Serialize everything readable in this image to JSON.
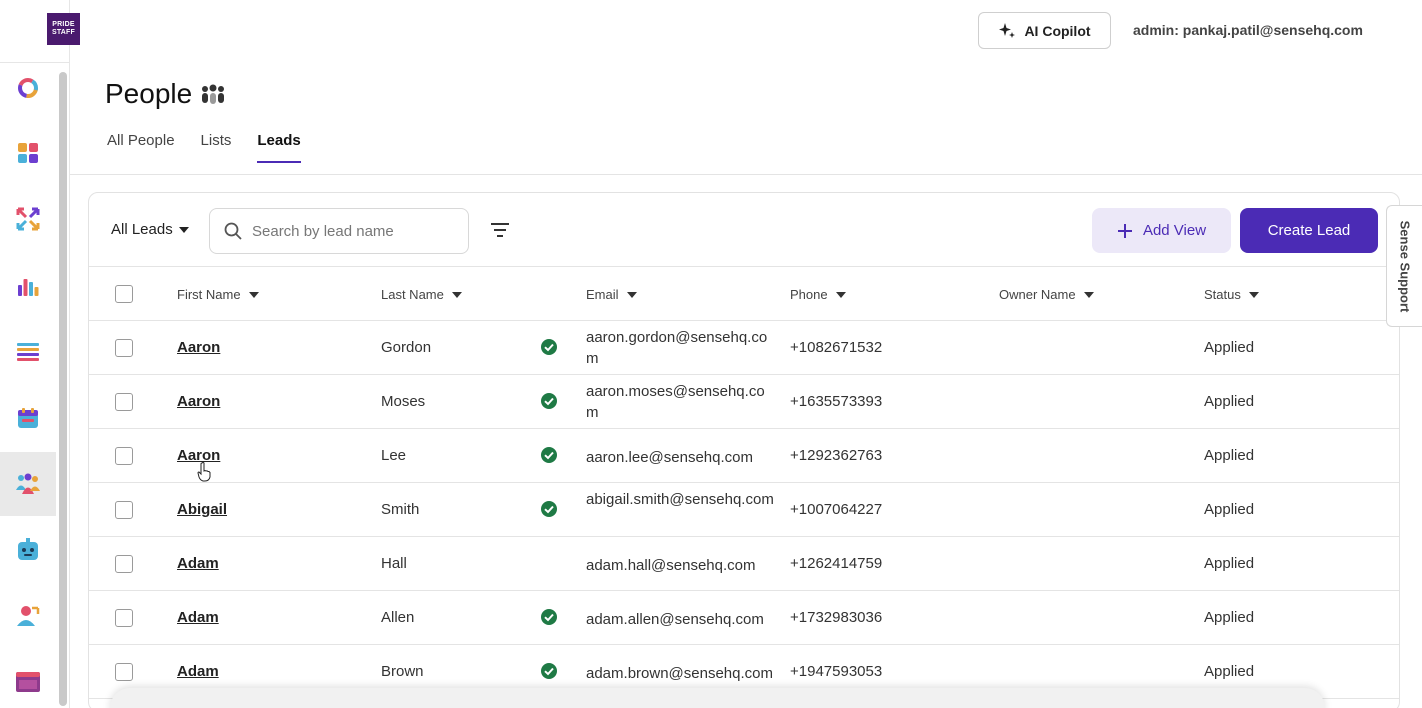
{
  "brand": {
    "logo_text_1": "PRIDE",
    "logo_text_2": "STAFF",
    "accent": "#4b2bb5",
    "logo_bg": "#4a1a6e"
  },
  "topbar": {
    "copilot_label": "AI Copilot",
    "admin_label": "admin: pankaj.patil@sensehq.com"
  },
  "sidebar": {
    "items": [
      {
        "icon": "ring-chart-icon"
      },
      {
        "icon": "apps-grid-icon"
      },
      {
        "icon": "arrows-swap-icon"
      },
      {
        "icon": "bar-chart-icon"
      },
      {
        "icon": "list-lines-icon"
      },
      {
        "icon": "calendar-icon"
      },
      {
        "icon": "people-icon",
        "active": true
      },
      {
        "icon": "bot-icon"
      },
      {
        "icon": "user-arrow-icon"
      },
      {
        "icon": "browser-window-icon"
      }
    ]
  },
  "page": {
    "title": "People",
    "tabs": [
      {
        "label": "All People",
        "active": false
      },
      {
        "label": "Lists",
        "active": false
      },
      {
        "label": "Leads",
        "active": true
      }
    ]
  },
  "toolbar": {
    "view_select": "All Leads",
    "search_placeholder": "Search by lead name",
    "add_view_label": "Add View",
    "create_lead_label": "Create Lead"
  },
  "table": {
    "columns": [
      "First Name",
      "Last Name",
      "Email",
      "Phone",
      "Owner Name",
      "Status"
    ],
    "rows": [
      {
        "first": "Aaron",
        "last": "Gordon",
        "verified": true,
        "email": "aaron.gordon@sensehq.com",
        "phone": "+1082671532",
        "owner": "",
        "status": "Applied"
      },
      {
        "first": "Aaron",
        "last": "Moses",
        "verified": true,
        "email": "aaron.moses@sensehq.com",
        "phone": "+1635573393",
        "owner": "",
        "status": "Applied"
      },
      {
        "first": "Aaron",
        "last": "Lee",
        "verified": true,
        "email": "aaron.lee@sensehq.com",
        "phone": "+1292362763",
        "owner": "",
        "status": "Applied"
      },
      {
        "first": "Abigail",
        "last": "Smith",
        "verified": true,
        "email": "abigail.smith@sensehq.com",
        "phone": "+1007064227",
        "owner": "",
        "status": "Applied"
      },
      {
        "first": "Adam",
        "last": "Hall",
        "verified": false,
        "email": "adam.hall@sensehq.com",
        "phone": "+1262414759",
        "owner": "",
        "status": "Applied"
      },
      {
        "first": "Adam",
        "last": "Allen",
        "verified": true,
        "email": "adam.allen@sensehq.com",
        "phone": "+1732983036",
        "owner": "",
        "status": "Applied"
      },
      {
        "first": "Adam",
        "last": "Brown",
        "verified": true,
        "email": "adam.brown@sensehq.com",
        "phone": "+1947593053",
        "owner": "",
        "status": "Applied"
      }
    ]
  },
  "side_tab": {
    "label": "Sense Support"
  }
}
